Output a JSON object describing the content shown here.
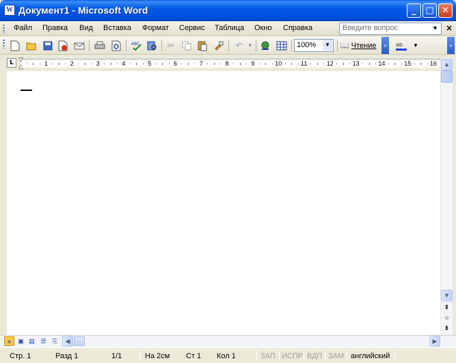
{
  "window": {
    "title": "Документ1 - Microsoft Word",
    "icon_letter": "W",
    "minimize": "_",
    "maximize": "□",
    "close": "✕"
  },
  "menu": {
    "items": [
      {
        "label": "Файл"
      },
      {
        "label": "Правка"
      },
      {
        "label": "Вид"
      },
      {
        "label": "Вставка"
      },
      {
        "label": "Формат"
      },
      {
        "label": "Сервис"
      },
      {
        "label": "Таблица"
      },
      {
        "label": "Окно"
      },
      {
        "label": "Справка"
      }
    ],
    "ask_placeholder": "Введите вопрос",
    "close_doc": "×"
  },
  "toolbar": {
    "zoom": "100%",
    "read_label": "Чтение",
    "icons": [
      "new-icon",
      "open-icon",
      "save-icon",
      "permission-icon",
      "email-icon",
      "print-icon",
      "print-preview-icon",
      "spelling-icon",
      "research-icon",
      "cut-icon",
      "copy-icon",
      "paste-icon",
      "format-painter-icon",
      "undo-icon",
      "hyperlink-icon",
      "table-icon",
      "highlight-icon"
    ]
  },
  "ruler": {
    "tab_selector": "L",
    "numbers": [
      "1",
      "2",
      "3",
      "4",
      "5",
      "6",
      "7",
      "8",
      "9",
      "10",
      "11",
      "12",
      "13",
      "14",
      "15",
      "16"
    ]
  },
  "statusbar": {
    "page": "Стр. 1",
    "section": "Разд 1",
    "pages": "1/1",
    "position": "На 2см",
    "line": "Ст 1",
    "column": "Кол 1",
    "rec": "ЗАП",
    "trk": "ИСПР",
    "ext": "ВДП",
    "ovr": "ЗАМ",
    "language": "английский"
  },
  "colors": {
    "titlebar": "#0058e6",
    "chrome": "#ece9d8",
    "page": "#ffffff"
  }
}
